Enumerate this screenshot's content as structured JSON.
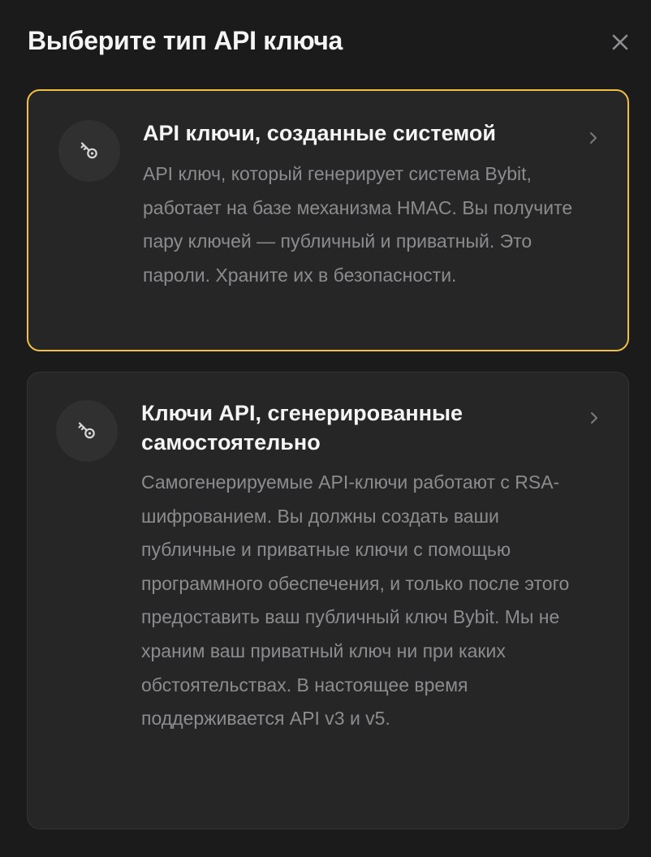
{
  "dialog": {
    "title": "Выберите тип API ключа",
    "close_icon": "close-icon"
  },
  "options": [
    {
      "icon": "key-icon",
      "title": "API ключи, созданные системой",
      "description": "API ключ, который генерирует система Bybit, работает на базе механизма HMAC. Вы получите пару ключей — публичный и приватный. Это пароли. Храните их в безопасности.",
      "selected": true
    },
    {
      "icon": "key-icon",
      "title": "Ключи API, сгенерированные самостоятельно",
      "description": "Самогенерируемые API-ключи работают с RSA-шифрованием. Вы должны создать ваши публичные и приватные ключи с помощью программного обеспечения, и только после этого предоставить ваш публичный ключ Bybit. Мы не храним ваш приватный ключ ни при каких обстоятельствах. В настоящее время поддерживается API v3 и v5.",
      "selected": false
    }
  ],
  "colors": {
    "background": "#1b1b1c",
    "card": "#262627",
    "selected_border": "#f0c044",
    "description_text": "#8c8c8e"
  }
}
